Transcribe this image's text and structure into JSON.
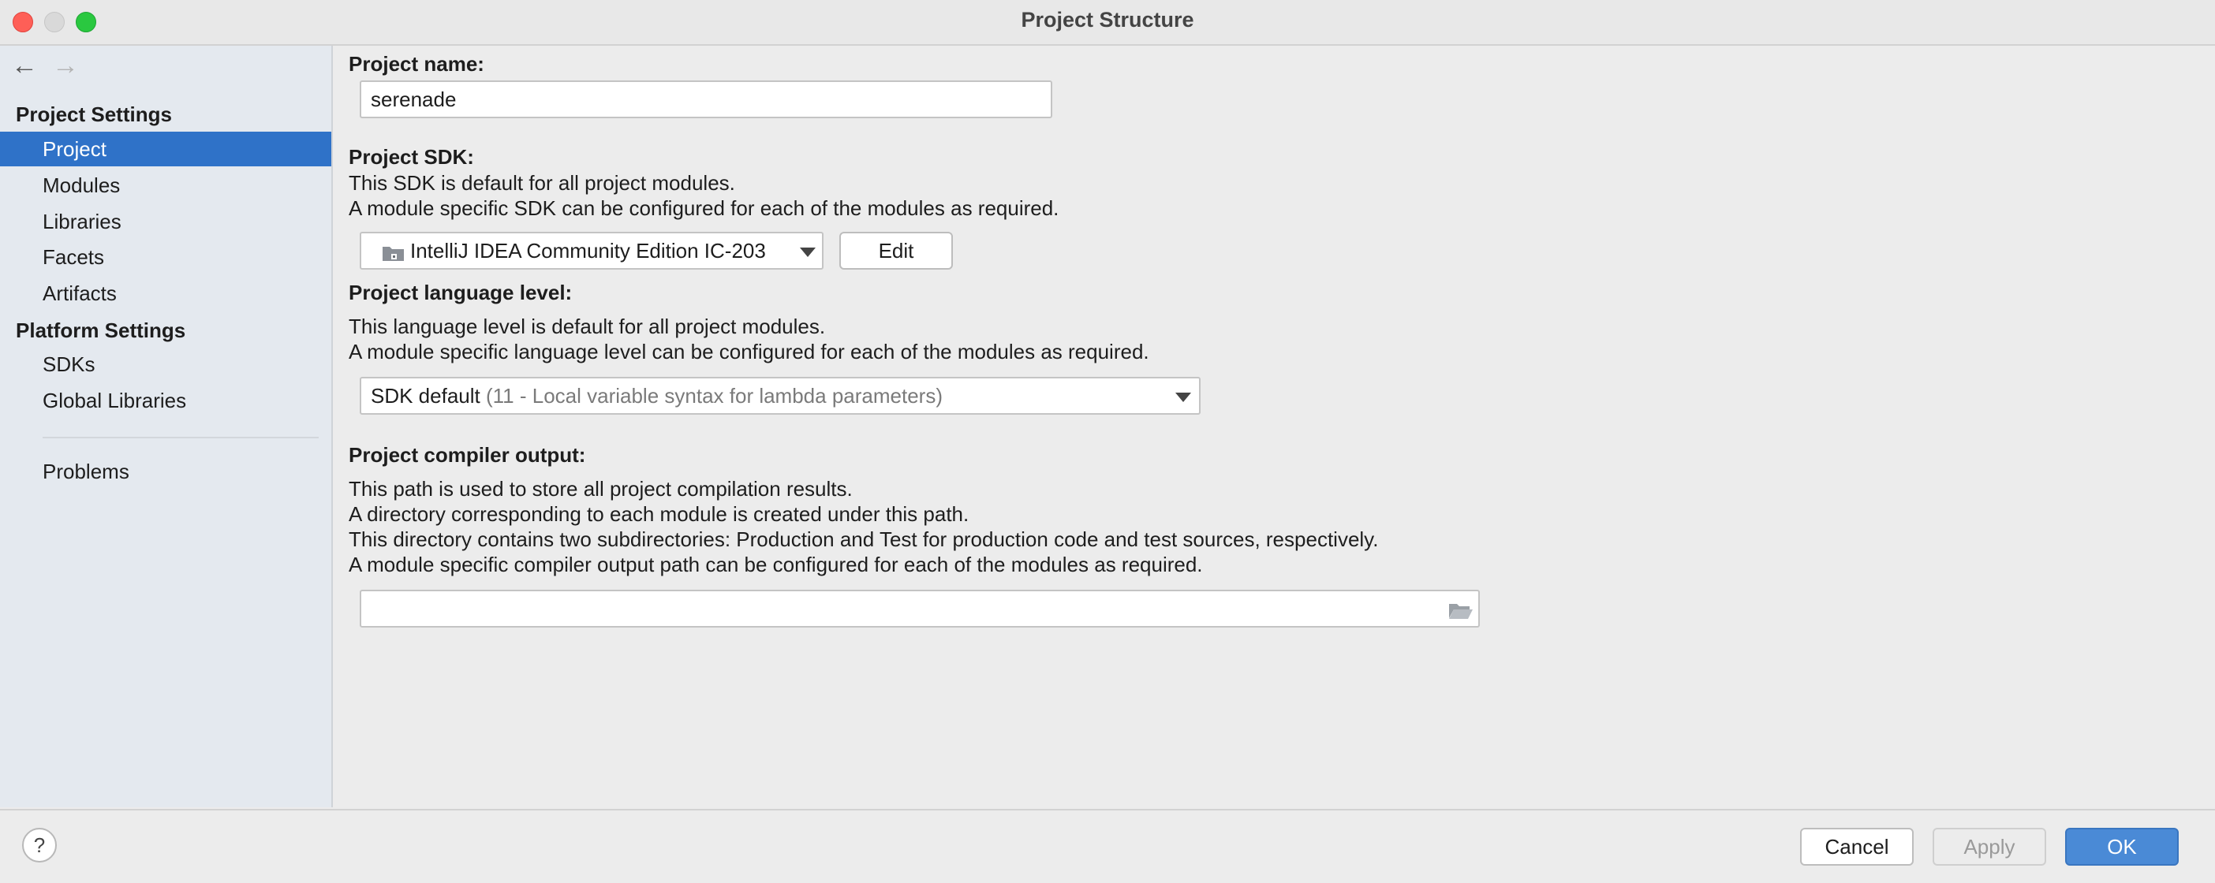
{
  "window": {
    "title": "Project Structure"
  },
  "nav": {
    "back_icon": "←",
    "forward_icon": "→"
  },
  "sidebar": {
    "project_settings_header": "Project Settings",
    "project_items": [
      {
        "label": "Project",
        "selected": true
      },
      {
        "label": "Modules"
      },
      {
        "label": "Libraries"
      },
      {
        "label": "Facets"
      },
      {
        "label": "Artifacts"
      }
    ],
    "platform_settings_header": "Platform Settings",
    "platform_items": [
      {
        "label": "SDKs"
      },
      {
        "label": "Global Libraries"
      }
    ],
    "problems_label": "Problems"
  },
  "project_name": {
    "label": "Project name:",
    "value": "serenade"
  },
  "project_sdk": {
    "label": "Project SDK:",
    "desc1": "This SDK is default for all project modules.",
    "desc2": "A module specific SDK can be configured for each of the modules as required.",
    "selected": "IntelliJ IDEA Community Edition IC-203",
    "edit_label": "Edit"
  },
  "language_level": {
    "label": "Project language level:",
    "desc1": "This language level is default for all project modules.",
    "desc2": "A module specific language level can be configured for each of the modules as required.",
    "selected_main": "SDK default",
    "selected_hint": "(11 - Local variable syntax for lambda parameters)"
  },
  "compiler_output": {
    "label": "Project compiler output:",
    "desc1": "This path is used to store all project compilation results.",
    "desc2": "A directory corresponding to each module is created under this path.",
    "desc3": "This directory contains two subdirectories: Production and Test for production code and test sources, respectively.",
    "desc4": "A module specific compiler output path can be configured for each of the modules as required.",
    "value": ""
  },
  "footer": {
    "help_label": "?",
    "cancel_label": "Cancel",
    "apply_label": "Apply",
    "ok_label": "OK"
  },
  "colors": {
    "accent": "#2f72c8",
    "ok_button": "#4a8ad6",
    "sidebar_bg": "#e4e9ef"
  }
}
